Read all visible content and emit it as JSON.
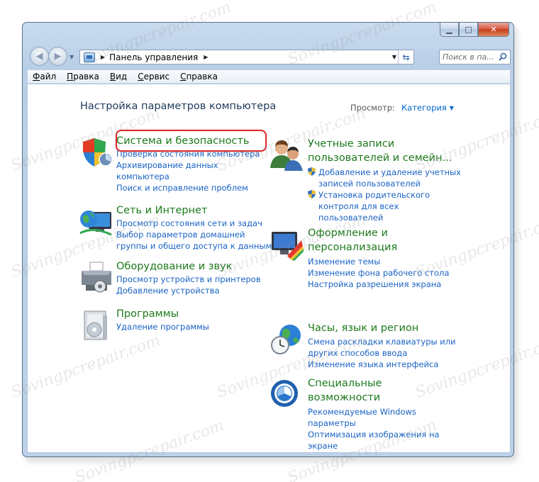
{
  "address": {
    "crumb": "Панель управления"
  },
  "search": {
    "placeholder": "Поиск в па..."
  },
  "menu": [
    {
      "letter": "Ф",
      "rest": "айл"
    },
    {
      "letter": "П",
      "rest": "равка"
    },
    {
      "letter": "В",
      "rest": "ид"
    },
    {
      "letter": "С",
      "rest": "ервис"
    },
    {
      "letter": "С",
      "rest": "правка"
    }
  ],
  "content": {
    "title": "Настройка параметров компьютера",
    "view_label": "Просмотр:",
    "view_value": "Категория"
  },
  "categories": {
    "system": {
      "title": "Система и безопасность",
      "links": [
        "Проверка состояния компьютера",
        "Архивирование данных",
        "компьютера",
        "Поиск и исправление проблем"
      ]
    },
    "network": {
      "title": "Сеть и Интернет",
      "links": [
        "Просмотр состояния сети и задач",
        "Выбор параметров домашней",
        "группы и общего доступа к данным"
      ]
    },
    "hardware": {
      "title": "Оборудование и звук",
      "links": [
        "Просмотр устройств и принтеров",
        "Добавление устройства"
      ]
    },
    "programs": {
      "title": "Программы",
      "links": [
        "Удаление программы"
      ]
    },
    "accounts": {
      "title_1": "Учетные записи",
      "title_2": "пользователей и семейн...",
      "links": [
        "Добавление и удаление учетных",
        "записей пользователей",
        "Установка родительского",
        "контроля для всех",
        "пользователей"
      ]
    },
    "appearance": {
      "title_1": "Оформление и",
      "title_2": "персонализация",
      "links": [
        "Изменение темы",
        "Изменение фона рабочего стола",
        "Настройка разрешения экрана"
      ]
    },
    "clock": {
      "title": "Часы, язык и регион",
      "links": [
        "Смена раскладки клавиатуры или",
        "других способов ввода",
        "Изменение языка интерфейса"
      ]
    },
    "access": {
      "title_1": "Специальные",
      "title_2": "возможности",
      "links": [
        "Рекомендуемые Windows",
        "параметры",
        "Оптимизация изображения на",
        "экране"
      ]
    }
  },
  "watermark": "Sovingpcrepair.com"
}
